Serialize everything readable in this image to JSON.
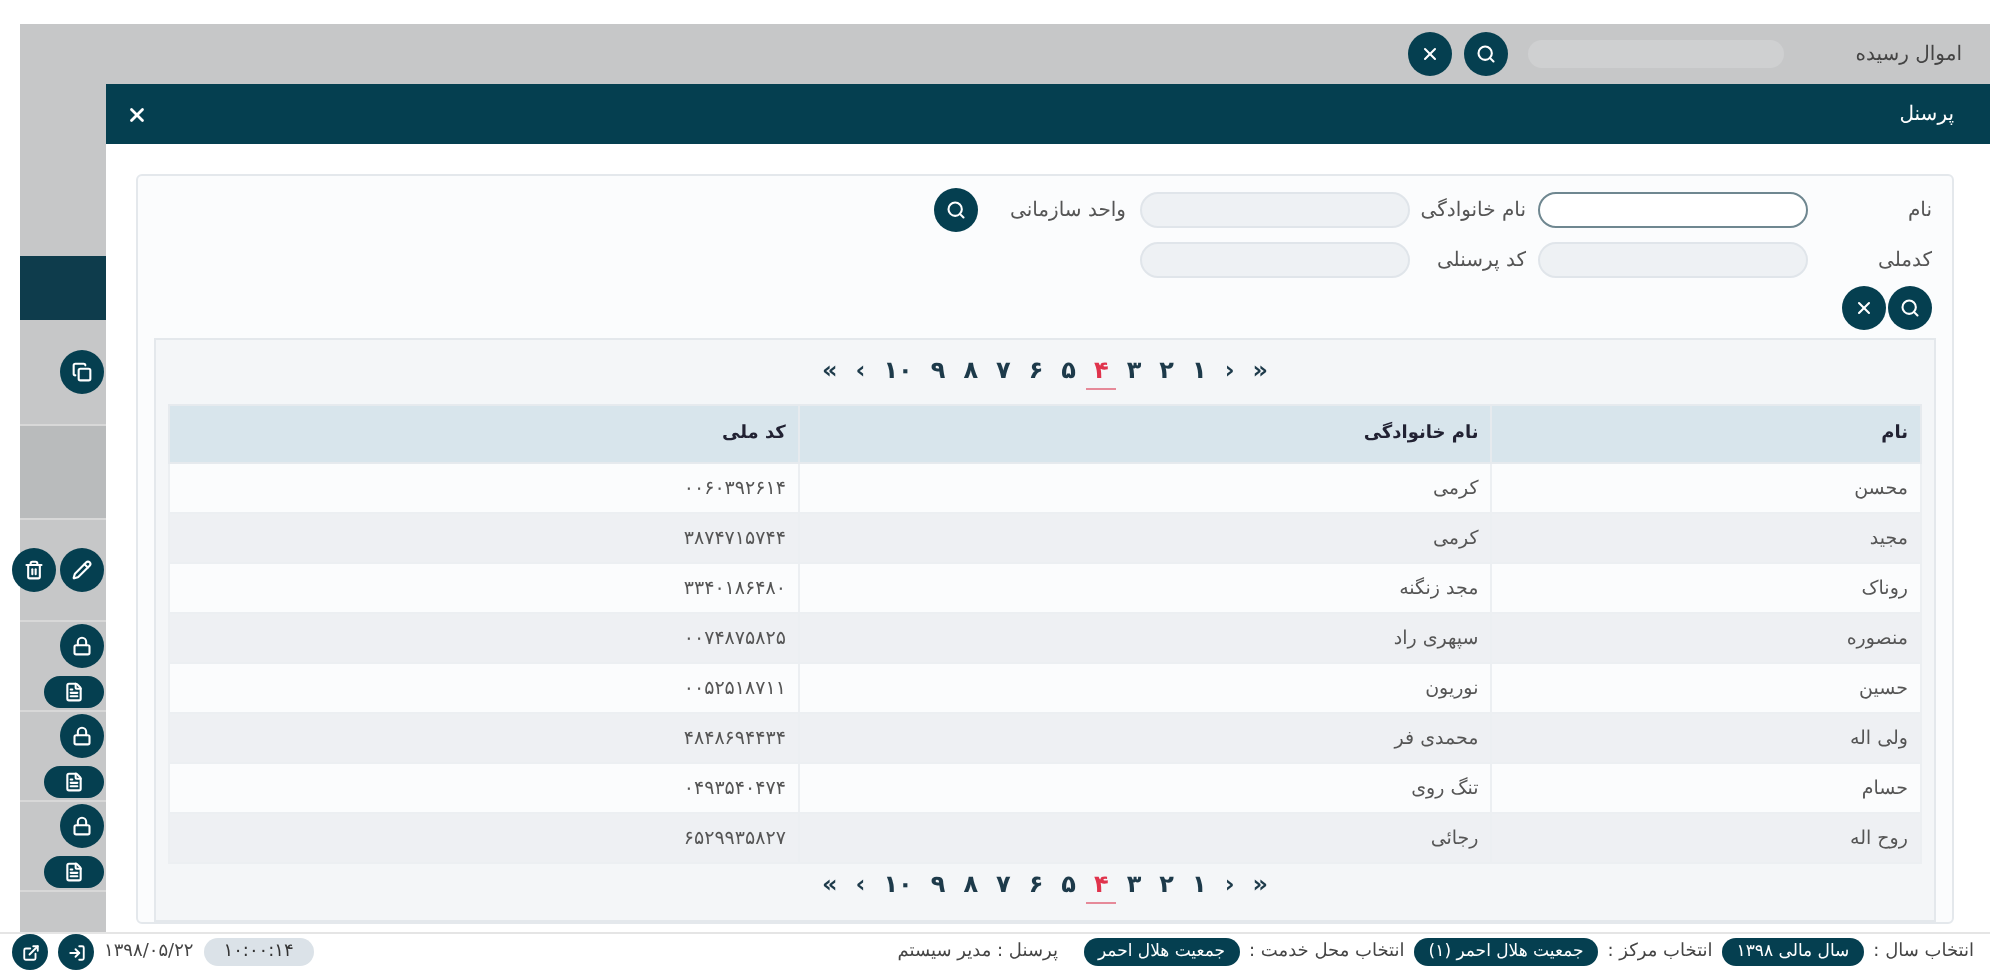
{
  "background": {
    "label": "اموال رسیده"
  },
  "dialog": {
    "title": "پرسنل"
  },
  "form": {
    "rows": [
      [
        {
          "kind": "text",
          "label": "نام",
          "focused": true
        },
        {
          "kind": "text",
          "label": "نام خانوادگی",
          "focused": false
        },
        {
          "kind": "lookup",
          "label": "واحد سازمانی"
        }
      ],
      [
        {
          "kind": "text",
          "label": "کدملی",
          "focused": false
        },
        {
          "kind": "text",
          "label": "کد پرسنلی",
          "focused": false
        }
      ]
    ]
  },
  "pagination": [
    {
      "label": "»",
      "selected": false
    },
    {
      "label": "›",
      "selected": false
    },
    {
      "label": "۱",
      "selected": false
    },
    {
      "label": "۲",
      "selected": false
    },
    {
      "label": "۳",
      "selected": false
    },
    {
      "label": "۴",
      "selected": true
    },
    {
      "label": "۵",
      "selected": false
    },
    {
      "label": "۶",
      "selected": false
    },
    {
      "label": "۷",
      "selected": false
    },
    {
      "label": "۸",
      "selected": false
    },
    {
      "label": "۹",
      "selected": false
    },
    {
      "label": "۱۰",
      "selected": false
    },
    {
      "label": "‹",
      "selected": false
    },
    {
      "label": "«",
      "selected": false
    }
  ],
  "table": {
    "columns": [
      "نام",
      "نام خانوادگی",
      "کد ملی"
    ],
    "rows": [
      [
        "محسن",
        "کرمی",
        "۰۰۶۰۳۹۲۶۱۴"
      ],
      [
        "مجید",
        "کرمی",
        "۳۸۷۴۷۱۵۷۴۴"
      ],
      [
        "روناک",
        "مجد زنگنه",
        "۳۳۴۰۱۸۶۴۸۰"
      ],
      [
        "منصوره",
        "سپهری راد",
        "۰۰۷۴۸۷۵۸۲۵"
      ],
      [
        "حسین",
        "نوریون",
        "۰۰۵۲۵۱۸۷۱۱"
      ],
      [
        "ولی اله",
        "محمدی فر",
        "۴۸۴۸۶۹۴۴۳۴"
      ],
      [
        "حسام",
        "تنگ روی",
        "۰۴۹۳۵۴۰۴۷۴"
      ],
      [
        "روح اله",
        "رجائی",
        "۶۵۲۹۹۳۵۸۲۷"
      ]
    ]
  },
  "pagination_bottom": [
    {
      "label": "»",
      "selected": false
    },
    {
      "label": "›",
      "selected": false
    },
    {
      "label": "۱",
      "selected": false
    },
    {
      "label": "۲",
      "selected": false
    },
    {
      "label": "۳",
      "selected": false
    },
    {
      "label": "۴",
      "selected": true
    },
    {
      "label": "۵",
      "selected": false
    },
    {
      "label": "۶",
      "selected": false
    },
    {
      "label": "۷",
      "selected": false
    },
    {
      "label": "۸",
      "selected": false
    },
    {
      "label": "۹",
      "selected": false
    },
    {
      "label": "۱۰",
      "selected": false
    },
    {
      "label": "‹",
      "selected": false
    },
    {
      "label": "«",
      "selected": false
    }
  ],
  "status_bar": {
    "selectors": [
      {
        "label": "انتخاب سال :",
        "value": "سال مالی ۱۳۹۸"
      },
      {
        "label": "انتخاب مرکز :",
        "value": "جمعیت هلال احمر (۱)"
      },
      {
        "label": "انتخاب محل خدمت :",
        "value": "جمعیت هلال احمر"
      }
    ],
    "user": "پرسنل : مدیر سیستم",
    "time": "۱۰:۰۰:۱۴",
    "date": "۱۳۹۸/۰۵/۲۲"
  }
}
